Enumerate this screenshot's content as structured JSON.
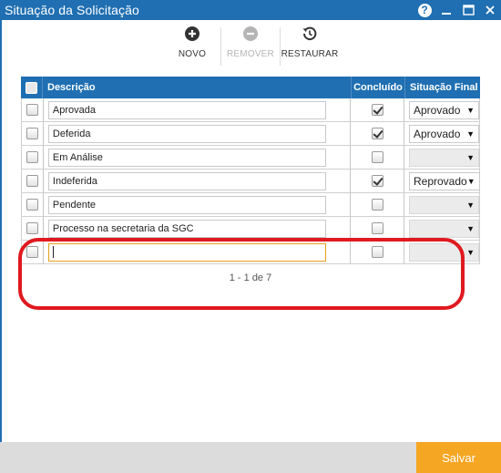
{
  "window": {
    "title": "Situação da Solicitação"
  },
  "toolbar": {
    "novo_label": "NOVO",
    "remover_label": "REMOVER",
    "restaurar_label": "RESTAURAR"
  },
  "grid": {
    "columns": {
      "descricao": "Descrição",
      "concluido": "Concluído",
      "situacao_final": "Situação Final"
    },
    "rows": [
      {
        "descricao": "Aprovada",
        "concluido": true,
        "situacao_final": "Aprovado"
      },
      {
        "descricao": "Deferida",
        "concluido": true,
        "situacao_final": "Aprovado"
      },
      {
        "descricao": "Em Análise",
        "concluido": false,
        "situacao_final": ""
      },
      {
        "descricao": "Indeferida",
        "concluido": true,
        "situacao_final": "Reprovado"
      },
      {
        "descricao": "Pendente",
        "concluido": false,
        "situacao_final": ""
      },
      {
        "descricao": "Processo na secretaria da SGC",
        "concluido": false,
        "situacao_final": ""
      },
      {
        "descricao": "",
        "concluido": false,
        "situacao_final": ""
      }
    ],
    "pager": "1 - 1 de 7",
    "dropdown_arrow": "▼"
  },
  "footer": {
    "save_label": "Salvar"
  },
  "colors": {
    "primary": "#1f6fb2",
    "save": "#f5a623",
    "highlight": "#e0191f",
    "active_input_border": "#e6a020"
  },
  "icons": {
    "help": "help-icon",
    "minimize": "minimize-icon",
    "maximize": "maximize-icon",
    "close": "close-icon",
    "novo": "plus-circle-icon",
    "remover": "minus-circle-icon",
    "restaurar": "history-icon"
  }
}
